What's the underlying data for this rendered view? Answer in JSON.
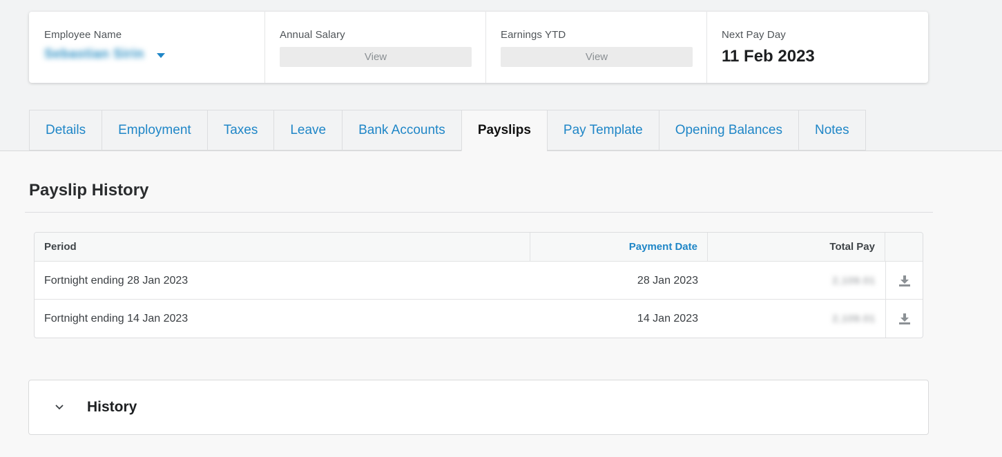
{
  "summary": {
    "employee_label": "Employee Name",
    "employee_name": "Sebastian Sirin",
    "salary_label": "Annual Salary",
    "salary_view": "View",
    "ytd_label": "Earnings YTD",
    "ytd_view": "View",
    "payday_label": "Next Pay Day",
    "payday_value": "11 Feb 2023"
  },
  "tabs": [
    {
      "label": "Details"
    },
    {
      "label": "Employment"
    },
    {
      "label": "Taxes"
    },
    {
      "label": "Leave"
    },
    {
      "label": "Bank Accounts"
    },
    {
      "label": "Payslips",
      "active": true
    },
    {
      "label": "Pay Template"
    },
    {
      "label": "Opening Balances"
    },
    {
      "label": "Notes"
    }
  ],
  "section": {
    "title": "Payslip History"
  },
  "table": {
    "headers": {
      "period": "Period",
      "payment_date": "Payment Date",
      "total_pay": "Total Pay"
    },
    "rows": [
      {
        "period": "Fortnight ending 28 Jan 2023",
        "payment_date": "28 Jan 2023",
        "total_pay": "2,109.01",
        "action_icon": "download-icon"
      },
      {
        "period": "Fortnight ending 14 Jan 2023",
        "payment_date": "14 Jan 2023",
        "total_pay": "2,109.01",
        "action_icon": "download-icon"
      }
    ]
  },
  "history": {
    "label": "History",
    "icon": "chevron-down-icon"
  },
  "colors": {
    "accent": "#1f86c7",
    "text": "#222222",
    "border": "#dcdddf"
  }
}
